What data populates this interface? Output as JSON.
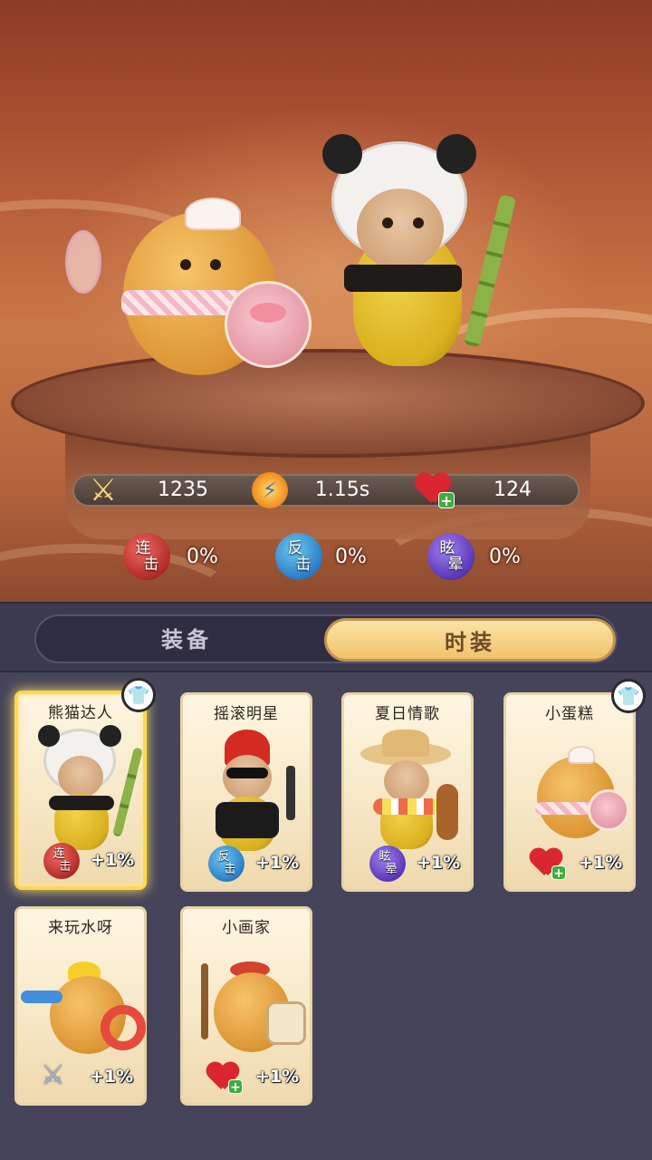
{
  "stats": {
    "attack": "1235",
    "speed": "1.15s",
    "hp": "124"
  },
  "skills": [
    {
      "c1": "连",
      "c2": "击",
      "pct": "0%",
      "color": "#b32a2a"
    },
    {
      "c1": "反",
      "c2": "击",
      "pct": "0%",
      "color": "#2a7ec4"
    },
    {
      "c1": "眩",
      "c2": "晕",
      "pct": "0%",
      "color": "#5a37b8"
    }
  ],
  "tabs": {
    "equip": "装备",
    "fashion": "时装"
  },
  "costumes": [
    {
      "name": "熊猫达人",
      "bonus": "+1%",
      "badge_c1": "连",
      "badge_c2": "击"
    },
    {
      "name": "摇滚明星",
      "bonus": "+1%",
      "badge_c1": "反",
      "badge_c2": "击"
    },
    {
      "name": "夏日情歌",
      "bonus": "+1%",
      "badge_c1": "眩",
      "badge_c2": "晕"
    },
    {
      "name": "小蛋糕",
      "bonus": "+1%"
    },
    {
      "name": "来玩水呀",
      "bonus": "+1%"
    },
    {
      "name": "小画家",
      "bonus": "+1%"
    }
  ],
  "icons": {
    "attack": "crossed-swords-icon",
    "speed": "speed-bolt-icon",
    "hp": "heart-plus-icon",
    "tag": "shirt-icon"
  }
}
